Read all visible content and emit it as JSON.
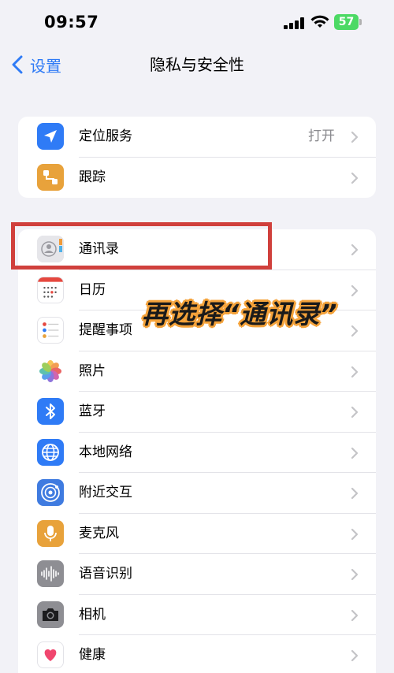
{
  "status_bar": {
    "time": "09:57",
    "battery": "57"
  },
  "nav": {
    "back_label": "设置",
    "title": "隐私与安全性"
  },
  "group1": [
    {
      "label": "定位服务",
      "value": "打开",
      "icon": "location-arrow-icon",
      "color": "#2f7bf6"
    },
    {
      "label": "跟踪",
      "value": "",
      "icon": "tracking-icon",
      "color": "#e8a23b"
    }
  ],
  "group2": [
    {
      "label": "通讯录",
      "icon": "contacts-icon"
    },
    {
      "label": "日历",
      "icon": "calendar-icon"
    },
    {
      "label": "提醒事项",
      "icon": "reminders-icon"
    },
    {
      "label": "照片",
      "icon": "photos-icon"
    },
    {
      "label": "蓝牙",
      "icon": "bluetooth-icon",
      "color": "#2f7bf6"
    },
    {
      "label": "本地网络",
      "icon": "globe-icon",
      "color": "#2f7bf6"
    },
    {
      "label": "附近交互",
      "icon": "nearby-icon",
      "color": "#3f7be0"
    },
    {
      "label": "麦克风",
      "icon": "microphone-icon",
      "color": "#e8a23b"
    },
    {
      "label": "语音识别",
      "icon": "waveform-icon",
      "color": "#8e8e93"
    },
    {
      "label": "相机",
      "icon": "camera-icon",
      "color": "#8e8e93"
    },
    {
      "label": "健康",
      "icon": "heart-icon",
      "color": "#ffffff"
    }
  ],
  "annotation": {
    "text": "再选择“通讯录”",
    "color": "#f4a23a"
  },
  "highlight": {
    "color": "#d0403c"
  }
}
